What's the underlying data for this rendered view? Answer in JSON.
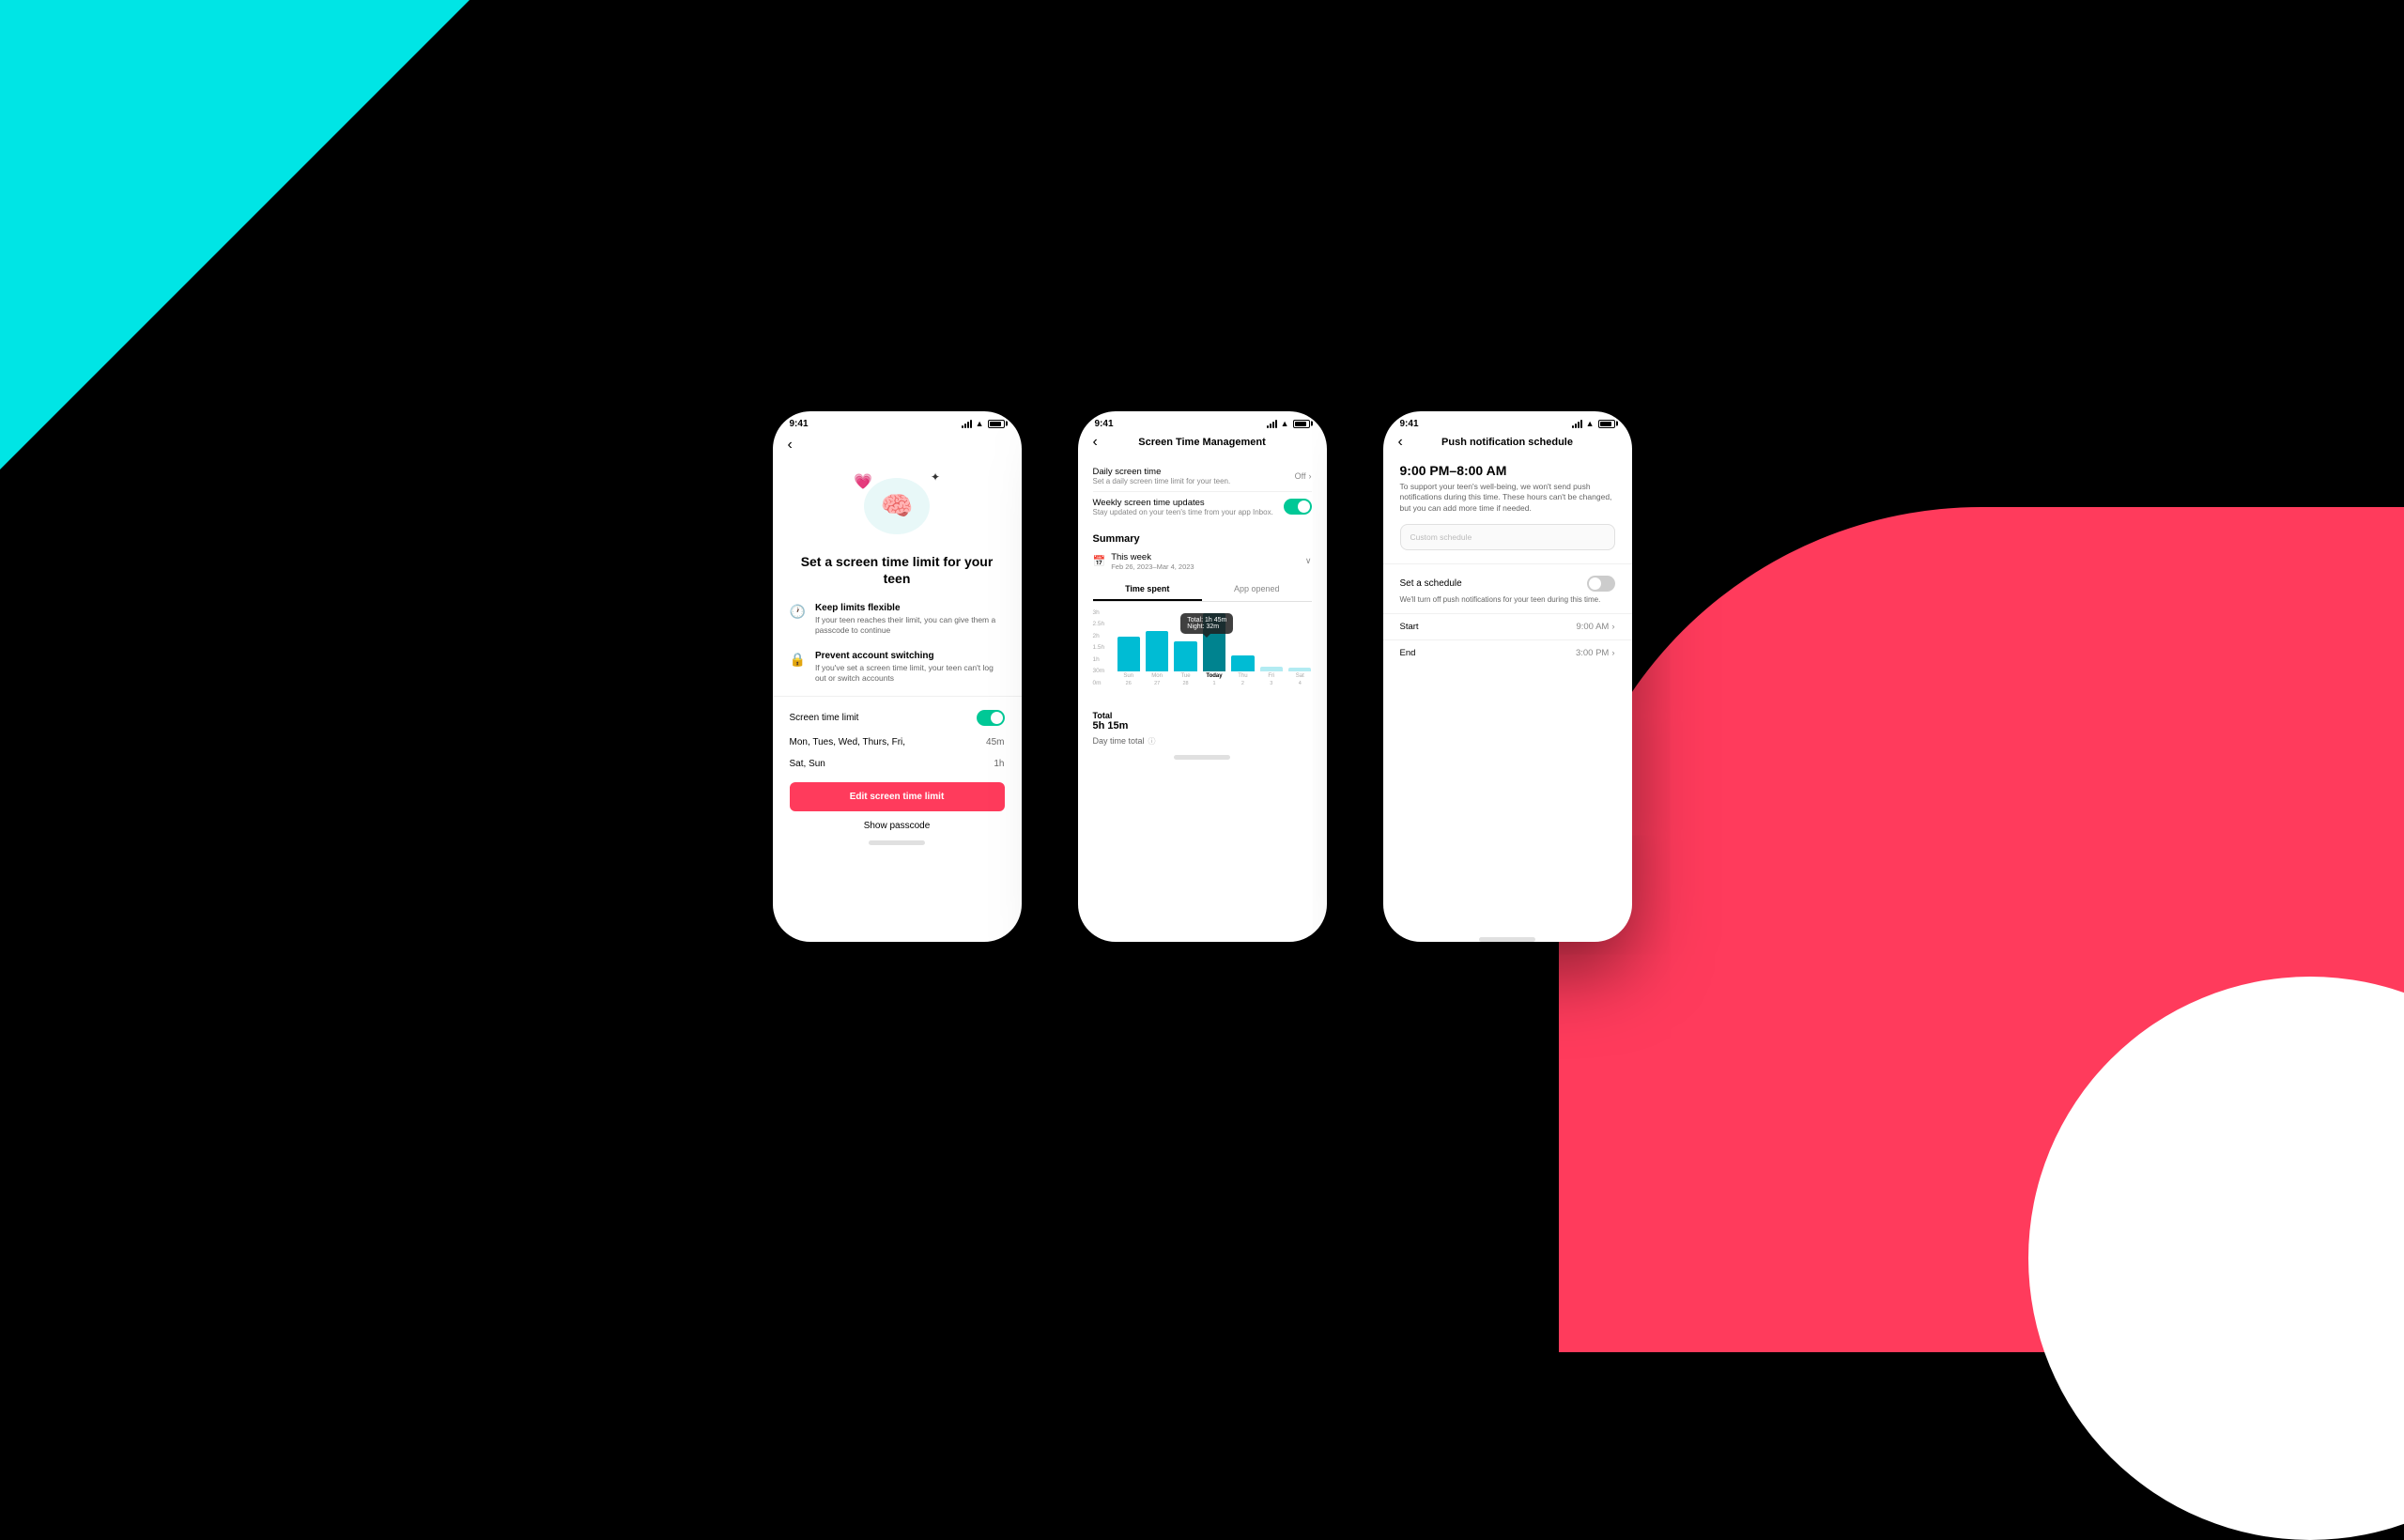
{
  "background": {
    "cyan_color": "#00e5e5",
    "pink_color": "#ff3b5c",
    "black_color": "#000000"
  },
  "phone1": {
    "status_time": "9:41",
    "title": "Set a screen time limit for your teen",
    "feature1_title": "Keep limits flexible",
    "feature1_desc": "If your teen reaches their limit, you can give them a passcode to continue",
    "feature2_title": "Prevent account switching",
    "feature2_desc": "If you've set a screen time limit, your teen can't log out or switch accounts",
    "screen_time_label": "Screen time limit",
    "weekday_label": "Mon, Tues, Wed, Thurs, Fri,",
    "weekday_value": "45m",
    "weekend_label": "Sat, Sun",
    "weekend_value": "1h",
    "edit_button": "Edit screen time limit",
    "show_passcode": "Show passcode"
  },
  "phone2": {
    "status_time": "9:41",
    "title": "Screen Time Management",
    "daily_title": "Daily screen time",
    "daily_desc": "Set a daily screen time limit for your teen.",
    "daily_value": "Off",
    "weekly_title": "Weekly screen time updates",
    "weekly_desc": "Stay updated on your teen's time from your app Inbox.",
    "summary_label": "Summary",
    "this_week": "This week",
    "date_range": "Feb 26, 2023–Mar 4, 2023",
    "tab1": "Time spent",
    "tab2": "App opened",
    "tooltip_total": "Total: 1h 45m",
    "tooltip_night": "Night: 32m",
    "chart_bars": [
      {
        "day": "Sun",
        "date": "26",
        "height": 45,
        "color": "#00bcd4"
      },
      {
        "day": "Mon",
        "date": "27",
        "height": 52,
        "color": "#00bcd4"
      },
      {
        "day": "Tue",
        "date": "28",
        "height": 38,
        "color": "#00bcd4"
      },
      {
        "day": "Today",
        "date": "1",
        "height": 75,
        "color": "#00bcd4",
        "today": true
      },
      {
        "day": "Thu",
        "date": "2",
        "height": 20,
        "color": "#00bcd4"
      },
      {
        "day": "Fri",
        "date": "3",
        "height": 10,
        "color": "#e0f7fa"
      },
      {
        "day": "Sat",
        "date": "4",
        "height": 10,
        "color": "#e0f7fa"
      }
    ],
    "y_labels": [
      "3h",
      "2.5h",
      "2h",
      "1.5h",
      "1h",
      "30m",
      "0m"
    ],
    "total_label": "Total",
    "total_value": "5h 15m",
    "day_total_label": "Day time total"
  },
  "phone3": {
    "status_time": "9:41",
    "title": "Push notification schedule",
    "time_range": "9:00 PM–8:00 AM",
    "description": "To support your teen's well-being, we won't send push notifications during this time. These hours can't be changed, but you can add more time if needed.",
    "custom_placeholder": "Custom schedule",
    "set_schedule_label": "Set a schedule",
    "set_schedule_desc": "We'll turn off push notifications for your teen during this time.",
    "start_label": "Start",
    "start_value": "9:00 AM",
    "end_label": "End",
    "end_value": "3:00 PM"
  }
}
